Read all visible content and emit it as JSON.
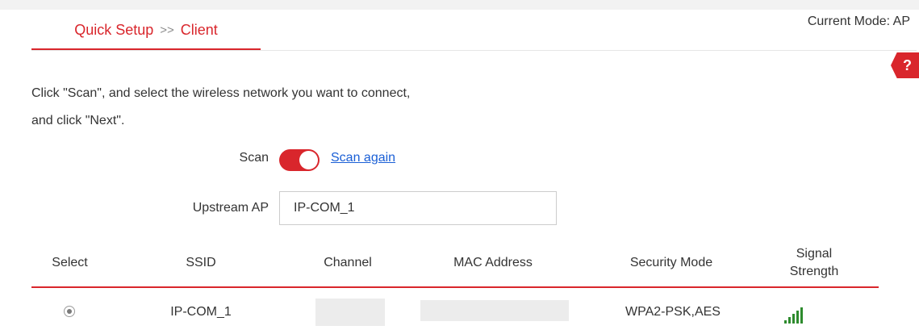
{
  "breadcrumb": {
    "parent": "Quick Setup",
    "separator": ">>",
    "current": "Client"
  },
  "current_mode": "Current Mode: AP",
  "help": {
    "label": "?",
    "icon": "help-icon"
  },
  "instructions": {
    "line1": "Click \"Scan\", and select the wireless network you want to connect,",
    "line2": "and click \"Next\"."
  },
  "scan": {
    "label": "Scan",
    "toggle_state": "on",
    "link_text": "Scan again"
  },
  "upstream": {
    "label": "Upstream AP",
    "value": "IP-COM_1"
  },
  "table": {
    "headers": [
      "Select",
      "SSID",
      "Channel",
      "MAC Address",
      "Security Mode",
      "Signal Strength"
    ],
    "signal_header_lines": [
      "Signal",
      "Strength"
    ],
    "rows": [
      {
        "selected": true,
        "ssid": "IP-COM_1",
        "channel": "",
        "mac": "",
        "security": "WPA2-PSK,AES",
        "signal_bars": 5
      }
    ]
  },
  "colors": {
    "accent": "#d9262c",
    "link": "#1a5fd6",
    "signal": "#2e8b2e"
  }
}
